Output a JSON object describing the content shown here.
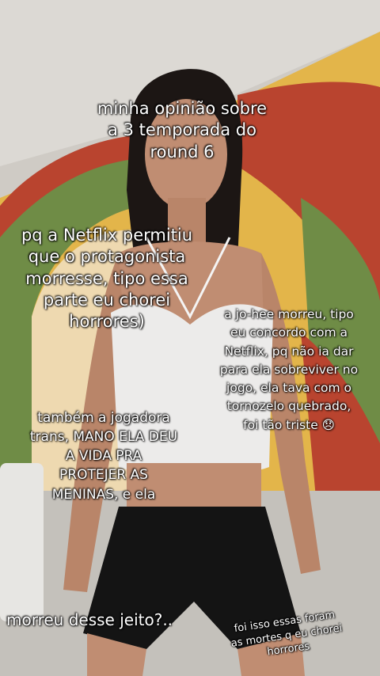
{
  "captions": {
    "title": "minha opinião sobre\na 3 temporada do\nround 6",
    "left": "pq a Netflix permitiu\nque o protagonista\nmorresse, tipo essa\nparte eu chorei\nhorrores)",
    "right": "a jo-hee morreu, tipo\neu concordo com a\nNetflix, pq não ia dar\npara ela sobreviver no\njogo, ela tava com o\ntornozelo quebrado,\nfoi tão triste 😞",
    "midleft": "também a jogadora\ntrans, MANO ELA DEU\nA VIDA PRA\nPROTEJER AS\nMENINAS, e ela",
    "bottom": "morreu desse jeito?..",
    "corner": "foi isso essas foram\nas mortes q eu chorei\nhorrores"
  },
  "photo": {
    "colors": {
      "ceiling": "#d9d6d1",
      "wall_green": "#6f8c46",
      "wall_red": "#b9442f",
      "wall_yellow": "#e3b54a",
      "wall_cream": "#eed9b0",
      "hair": "#1c1614",
      "skin": "#c08d72",
      "top_white": "#ecebea",
      "shorts": "#141414",
      "floor": "#c8c6c1"
    }
  }
}
